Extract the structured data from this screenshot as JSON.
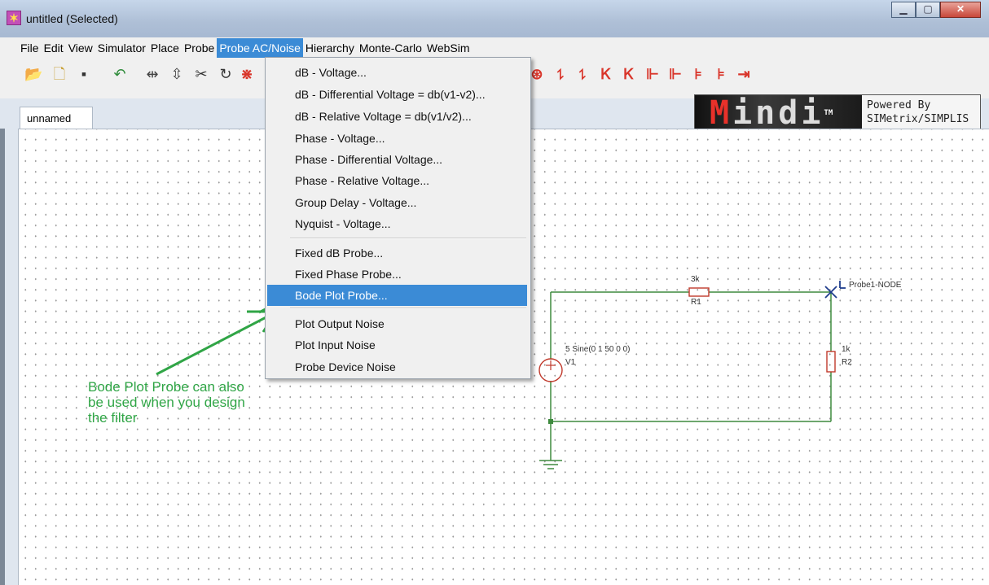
{
  "window": {
    "title": "untitled (Selected)",
    "icon": "app-star-icon",
    "controls": [
      "minimize",
      "maximize",
      "close"
    ]
  },
  "menubar": {
    "file": "File",
    "edit": "Edit",
    "view": "View",
    "simulator": "Simulator",
    "place": "Place",
    "probe": "Probe",
    "probe_ac_noise": "Probe AC/Noise",
    "hierarchy": "Hierarchy",
    "monte_carlo": "Monte-Carlo",
    "websim": "WebSim"
  },
  "probe_ac_menu": {
    "items": [
      "dB - Voltage...",
      "dB - Differential Voltage = db(v1-v2)...",
      "dB - Relative Voltage = db(v1/v2)...",
      "Phase - Voltage...",
      "Phase - Differential Voltage...",
      "Phase - Relative Voltage...",
      "Group Delay - Voltage...",
      "Nyquist - Voltage...",
      "Fixed dB Probe...",
      "Fixed Phase Probe...",
      "Bode Plot Probe...",
      "Plot Output Noise",
      "Plot Input Noise",
      "Probe Device Noise"
    ],
    "highlighted": "Bode Plot Probe..."
  },
  "logo": {
    "name": "Mindi",
    "mark": "TM",
    "powered_line1": "Powered By",
    "powered_line2": "SIMetrix/SIMPLIS"
  },
  "tab": {
    "label": "unnamed"
  },
  "schematic": {
    "r1_value": "3k",
    "r1_ref": "R1",
    "r2_value": "1k",
    "r2_ref": "R2",
    "v1_value": "5 Sine(0 1 50 0 0)",
    "v1_ref": "V1",
    "probe_label": "Probe1-NODE"
  },
  "annotation": {
    "text": "Bode Plot Probe can also be used when you design the filter"
  },
  "colors": {
    "menu_highlight": "#3b8bd6",
    "wire": "#3e8a3e",
    "schematic_part": "#c0392b",
    "annotation": "#30a546"
  }
}
